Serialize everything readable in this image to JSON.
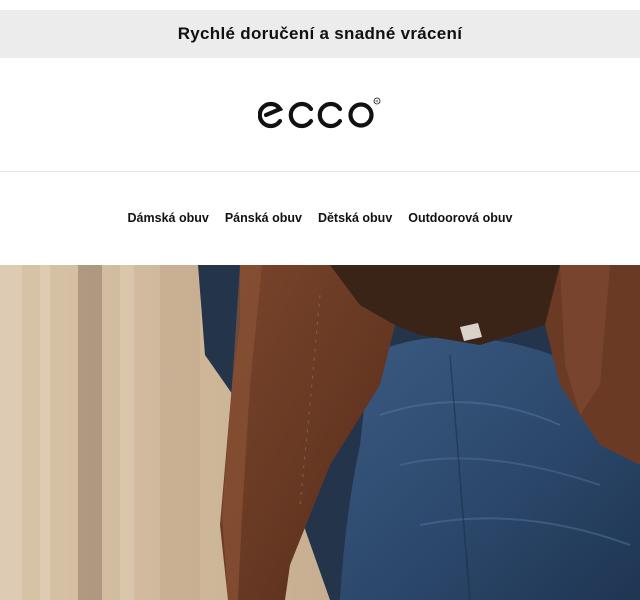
{
  "promo_bar": {
    "text": "Rychlé doručení a snadné vrácení"
  },
  "brand": {
    "logo_text": "ecco",
    "logo_color": "#111111"
  },
  "nav": {
    "items": [
      {
        "label": "Dámská obuv"
      },
      {
        "label": "Pánská obuv"
      },
      {
        "label": "Dětská obuv"
      },
      {
        "label": "Outdoorová obuv"
      }
    ]
  },
  "colors": {
    "promo_bg": "#ececec",
    "text": "#111111",
    "hero_background": "#d3bea3",
    "coat": "#6a3a24",
    "jeans": "#2f4b6e"
  }
}
